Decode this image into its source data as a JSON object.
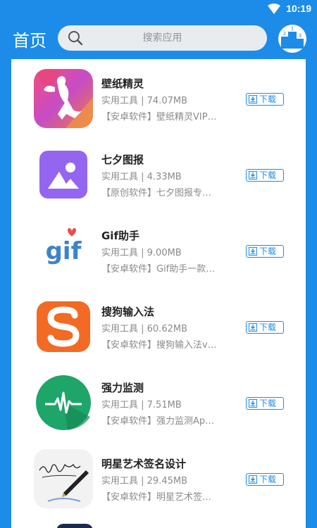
{
  "status": {
    "time": "10:19"
  },
  "header": {
    "title": "首页",
    "search_placeholder": "搜索应用"
  },
  "apps": [
    {
      "name": "壁纸精灵",
      "meta": "实用工具 | 74.07MB",
      "desc": "【安卓软件】壁纸精灵VIP…",
      "download": "下载"
    },
    {
      "name": "七夕图报",
      "meta": "实用工具 | 4.33MB",
      "desc": "【原创软件】七夕图报专…",
      "download": "下载"
    },
    {
      "name": "Gif助手",
      "meta": "实用工具 | 9.00MB",
      "desc": "【安卓软件】Gif助手一款…",
      "download": "下载"
    },
    {
      "name": "搜狗输入法",
      "meta": "实用工具 | 60.62MB",
      "desc": "【安卓软件】搜狗输入法v…",
      "download": "下载"
    },
    {
      "name": "强力监测",
      "meta": "实用工具 | 7.51MB",
      "desc": "【安卓软件】强力监测Ap…",
      "download": "下载"
    },
    {
      "name": "明星艺术签名设计",
      "meta": "实用工具 | 29.45MB",
      "desc": "【安卓软件】明星艺术签…",
      "download": "下载"
    }
  ],
  "icons": {
    "app1": "fairy-wallpaper-icon",
    "app2": "image-icon",
    "app3": "gif-icon",
    "app4": "sogou-s-icon",
    "app5": "heartbeat-icon",
    "app6": "signature-pen-icon",
    "rank": "ranking-podium-icon"
  },
  "colors": {
    "primary": "#1c8ce8",
    "text": "#222222",
    "secondary": "#8a8a8a"
  }
}
